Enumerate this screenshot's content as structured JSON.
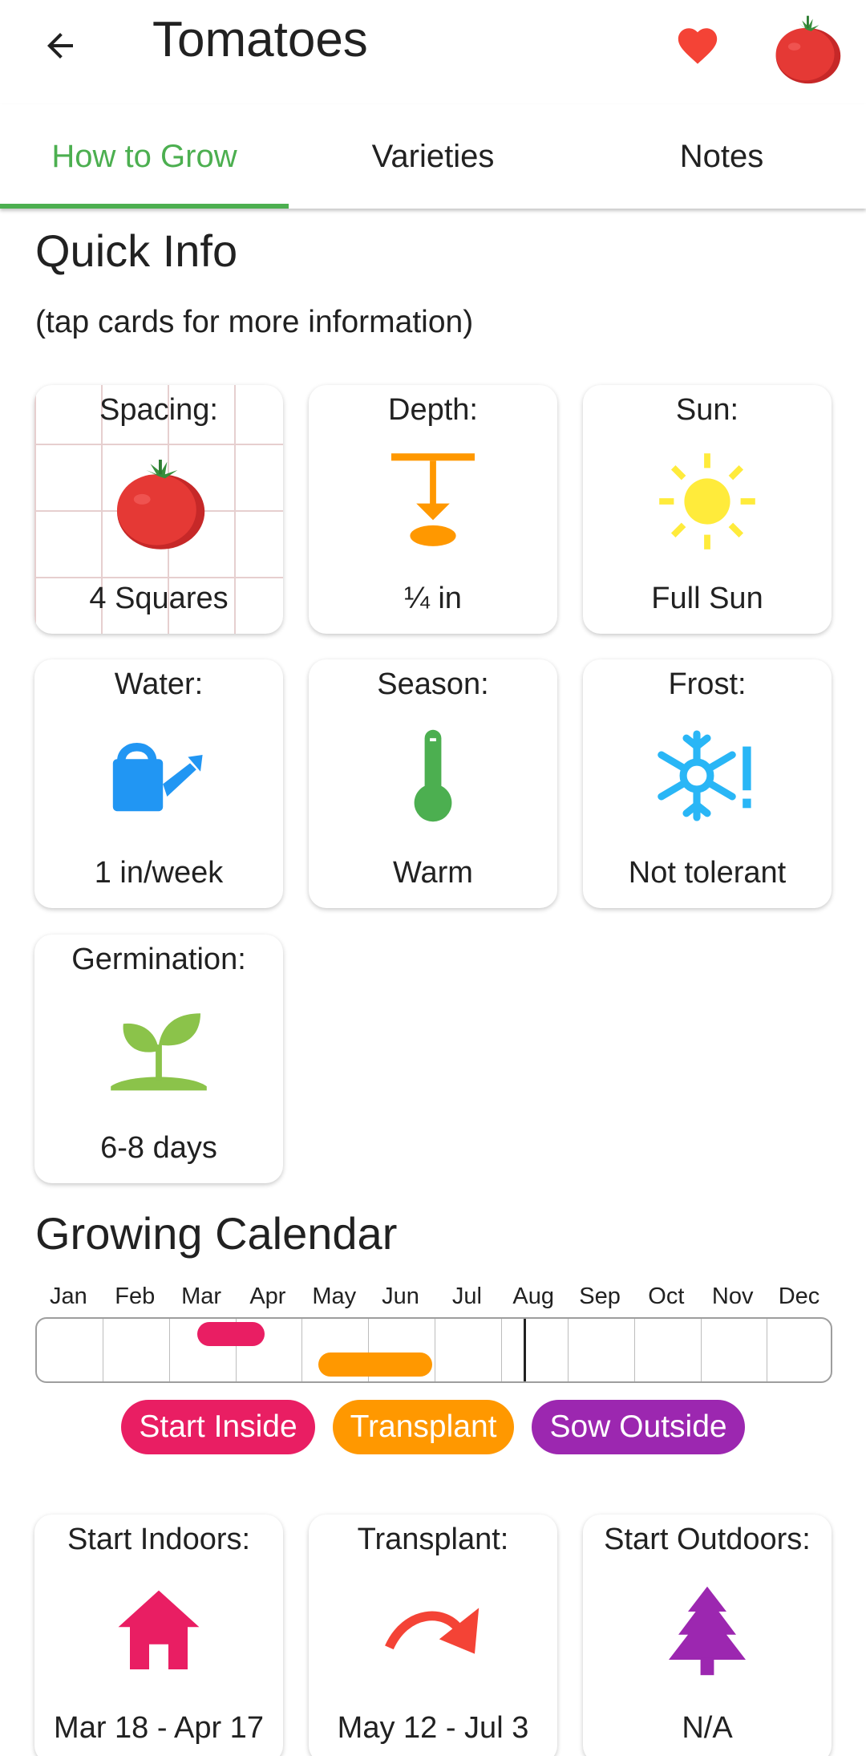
{
  "header": {
    "title": "Tomatoes",
    "back_icon": "arrow-left-icon",
    "favorite_icon": "heart-icon",
    "favorite_color": "#f44336"
  },
  "tabs": [
    {
      "label": "How to Grow",
      "active": true
    },
    {
      "label": "Varieties",
      "active": false
    },
    {
      "label": "Notes",
      "active": false
    }
  ],
  "accent_color": "#4caf50",
  "quick_info": {
    "heading": "Quick Info",
    "subtitle": "(tap cards for more information)",
    "cards": [
      {
        "label": "Spacing:",
        "value": "4 Squares",
        "icon": "tomato-icon"
      },
      {
        "label": "Depth:",
        "value": "¼ in",
        "icon": "seed-depth-icon"
      },
      {
        "label": "Sun:",
        "value": "Full Sun",
        "icon": "sun-icon"
      },
      {
        "label": "Water:",
        "value": "1 in/week",
        "icon": "watering-can-icon"
      },
      {
        "label": "Season:",
        "value": "Warm",
        "icon": "thermometer-icon"
      },
      {
        "label": "Frost:",
        "value": "Not tolerant",
        "icon": "snowflake-alert-icon"
      },
      {
        "label": "Germination:",
        "value": "6-8 days",
        "icon": "sprout-icon"
      }
    ]
  },
  "calendar": {
    "heading": "Growing Calendar",
    "months": [
      "Jan",
      "Feb",
      "Mar",
      "Apr",
      "May",
      "Jun",
      "Jul",
      "Aug",
      "Sep",
      "Oct",
      "Nov",
      "Dec"
    ],
    "legend": [
      {
        "label": "Start Inside",
        "color": "#e91e63"
      },
      {
        "label": "Transplant",
        "color": "#ff9800"
      },
      {
        "label": "Sow Outside",
        "color": "#9c27b0"
      }
    ]
  },
  "schedule_cards": [
    {
      "label": "Start Indoors:",
      "value": "Mar 18 - Apr 17",
      "icon": "house-icon"
    },
    {
      "label": "Transplant:",
      "value": "May 12 - Jul 3",
      "icon": "curved-arrow-icon"
    },
    {
      "label": "Start Outdoors:",
      "value": "N/A",
      "icon": "tree-icon"
    }
  ]
}
